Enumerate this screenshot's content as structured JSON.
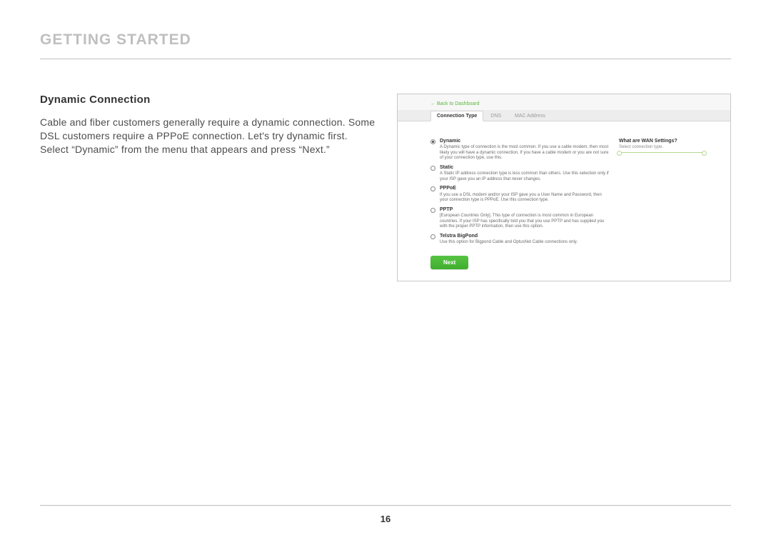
{
  "page_title": "GETTING STARTED",
  "section_heading": "Dynamic Connection",
  "body_text": "Cable and fiber customers generally require a dynamic connection. Some DSL customers require a PPPoE connection. Let's try dynamic first. Select “Dynamic” from the menu that appears and press “Next.”",
  "page_number": "16",
  "panel": {
    "back_link": "← Back to Dashboard",
    "tabs": [
      {
        "label": "Connection Type",
        "active": true
      },
      {
        "label": "DNS",
        "active": false
      },
      {
        "label": "MAC Address",
        "active": false
      }
    ],
    "sidebar": {
      "title": "What are WAN Settings?",
      "subtitle": "Select connection type."
    },
    "options": [
      {
        "label": "Dynamic",
        "checked": true,
        "desc": "A Dynamic type of connection is the most common. If you use a cable modem, then most likely you will have a dynamic connection. If you have a cable modem or you are not sure of your connection type, use this."
      },
      {
        "label": "Static",
        "checked": false,
        "desc": "A Static IP address connection type is less common than others. Use this selection only if your ISP gave you an IP address that never changes."
      },
      {
        "label": "PPPoE",
        "checked": false,
        "desc": "If you use a DSL modem and/or your ISP gave you a User Name and Password, then your connection type is PPPoE. Use this connection type."
      },
      {
        "label": "PPTP",
        "checked": false,
        "desc": "[European Countries Only]. This type of connection is most common in European countries. If your ISP has specifically told you that you use PPTP and has supplied you with the proper PPTP information, then use this option."
      },
      {
        "label": "Telstra BigPond",
        "checked": false,
        "desc": "Use this option for Bigpond Cable and OptusNet Cable connections only."
      }
    ],
    "next_label": "Next"
  }
}
